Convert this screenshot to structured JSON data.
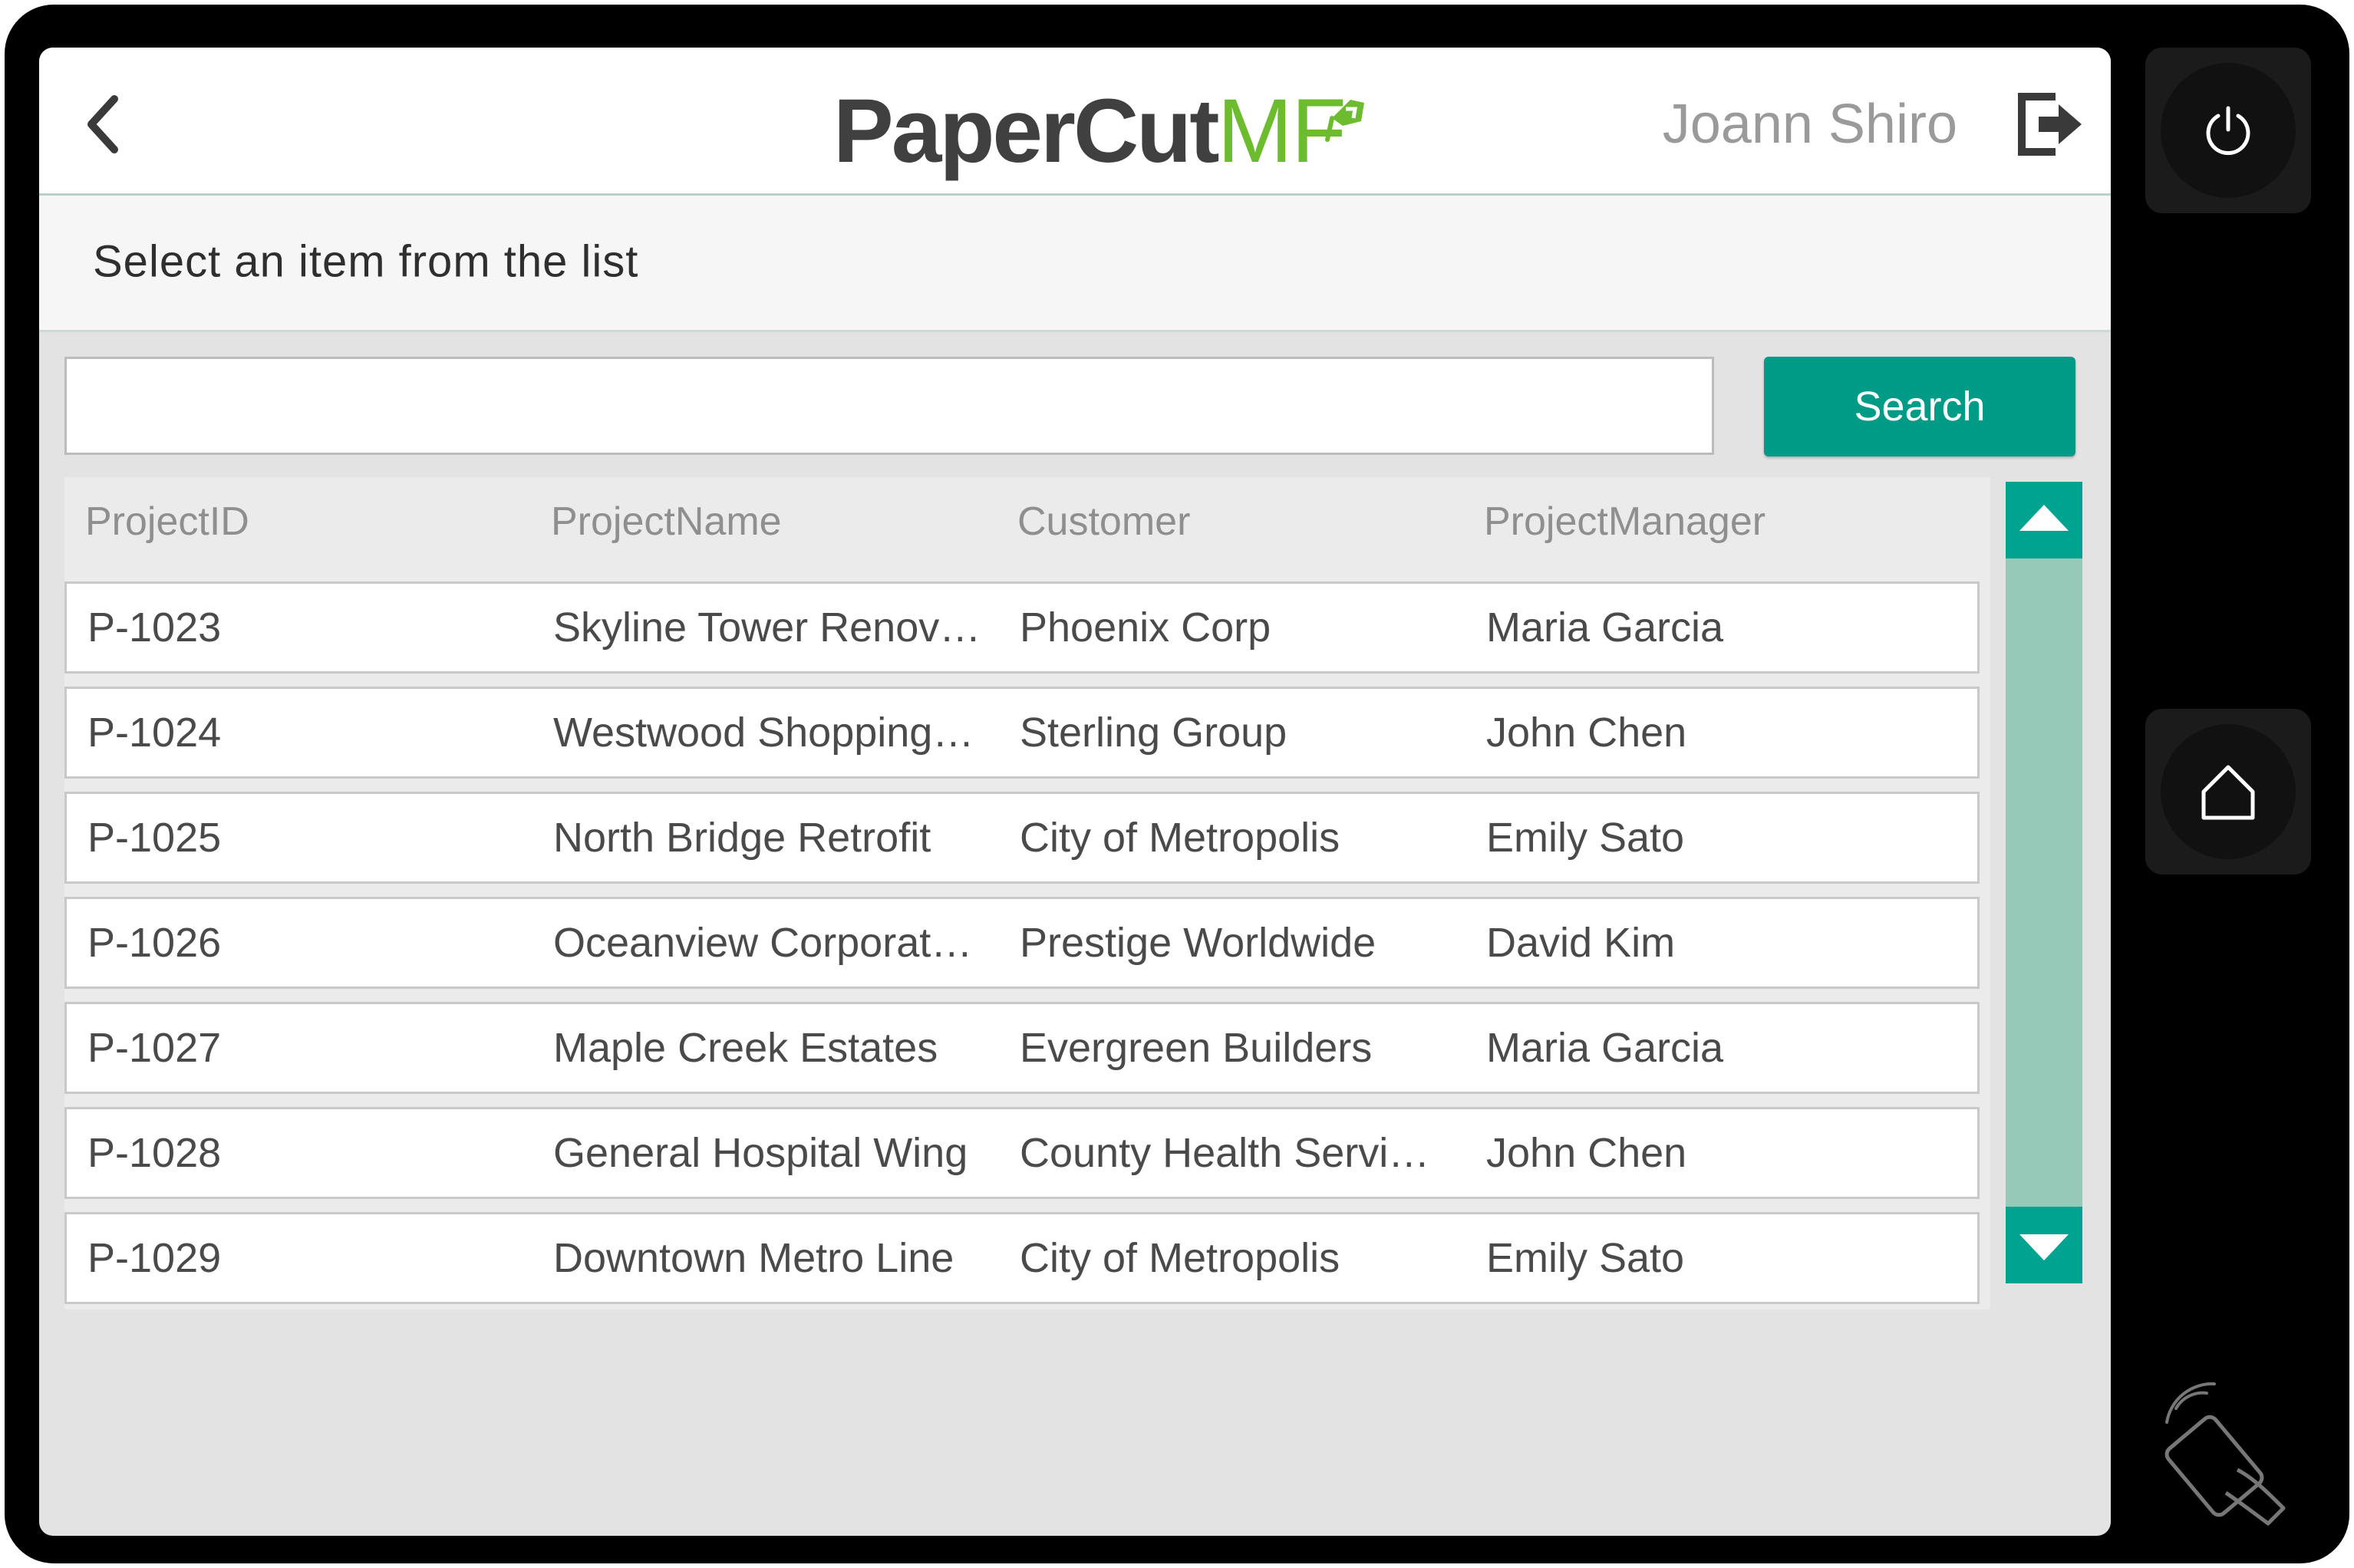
{
  "header": {
    "logo_primary": "PaperCut",
    "logo_secondary": "MF",
    "user_name": "Joann Shiro",
    "back_icon": "chevron-left-icon",
    "logout_icon": "logout-icon"
  },
  "instruction": "Select an item from the list",
  "search": {
    "value": "",
    "placeholder": "",
    "button_label": "Search"
  },
  "table": {
    "columns": [
      "ProjectID",
      "ProjectName",
      "Customer",
      "ProjectManager"
    ],
    "rows": [
      [
        "P-1023",
        "Skyline Tower Renovation",
        "Phoenix Corp",
        "Maria Garcia"
      ],
      [
        "P-1024",
        "Westwood Shopping Center",
        "Sterling Group",
        "John Chen"
      ],
      [
        "P-1025",
        "North Bridge Retrofit",
        "City of Metropolis",
        "Emily Sato"
      ],
      [
        "P-1026",
        "Oceanview Corporate Park",
        "Prestige Worldwide",
        "David Kim"
      ],
      [
        "P-1027",
        "Maple Creek Estates",
        "Evergreen Builders",
        "Maria Garcia"
      ],
      [
        "P-1028",
        "General Hospital Wing",
        "County Health Services",
        "John Chen"
      ],
      [
        "P-1029",
        "Downtown Metro Line",
        "City of Metropolis",
        "Emily Sato"
      ]
    ]
  },
  "scroll": {
    "up_icon": "triangle-up-icon",
    "down_icon": "triangle-down-icon"
  },
  "hardware": {
    "power_icon": "power-icon",
    "home_icon": "home-icon",
    "nfc_icon": "nfc-card-tap-icon"
  },
  "colors": {
    "accent": "#009b86",
    "scroll_track": "#96c9b8",
    "logo_green": "#6dbb2e",
    "bezel": "#000000"
  }
}
